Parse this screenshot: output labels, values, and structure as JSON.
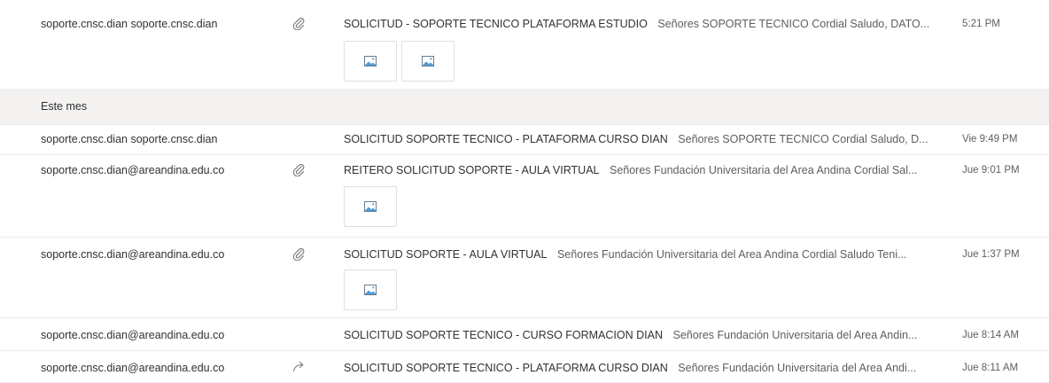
{
  "group": {
    "label": "Este mes"
  },
  "messages_top": [
    {
      "sender": "soporte.cnsc.dian soporte.cnsc.dian",
      "subject": "SOLICITUD - SOPORTE TECNICO PLATAFORMA ESTUDIO",
      "preview": "Señores SOPORTE TECNICO Cordial Saludo, DATO...",
      "time": "5:21 PM",
      "status_icon": "paperclip-icon",
      "attachments": 2
    }
  ],
  "messages": [
    {
      "sender": "soporte.cnsc.dian soporte.cnsc.dian",
      "subject": "SOLICITUD SOPORTE TECNICO - PLATAFORMA CURSO DIAN",
      "preview": "Señores SOPORTE TECNICO Cordial Saludo, D...",
      "time": "Vie 9:49 PM",
      "status_icon": "",
      "attachments": 0
    },
    {
      "sender": "soporte.cnsc.dian@areandina.edu.co",
      "subject": "REITERO SOLICITUD SOPORTE - AULA VIRTUAL",
      "preview": "Señores Fundación Universitaria del Area Andina Cordial Sal...",
      "time": "Jue 9:01 PM",
      "status_icon": "paperclip-icon",
      "attachments": 1
    },
    {
      "sender": "soporte.cnsc.dian@areandina.edu.co",
      "subject": "SOLICITUD SOPORTE - AULA VIRTUAL",
      "preview": "Señores Fundación Universitaria del Area Andina Cordial Saludo Teni...",
      "time": "Jue 1:37 PM",
      "status_icon": "paperclip-icon",
      "attachments": 1
    },
    {
      "sender": "soporte.cnsc.dian@areandina.edu.co",
      "subject": "SOLICITUD SOPORTE TECNICO - CURSO FORMACION DIAN",
      "preview": "Señores Fundación Universitaria del Area Andin...",
      "time": "Jue 8:14 AM",
      "status_icon": "",
      "attachments": 0
    },
    {
      "sender": "soporte.cnsc.dian@areandina.edu.co",
      "subject": "SOLICITUD SOPORTE TECNICO - PLATAFORMA CURSO DIAN",
      "preview": "Señores Fundación Universitaria del Area Andi...",
      "time": "Jue 8:11 AM",
      "status_icon": "forward-arrow-icon",
      "attachments": 0
    }
  ],
  "colors": {
    "border": "#edebe9",
    "group_background": "#f3f2f1",
    "text": "#323130",
    "muted": "#605e5c",
    "image_icon_blue": "#4f9cd9"
  }
}
